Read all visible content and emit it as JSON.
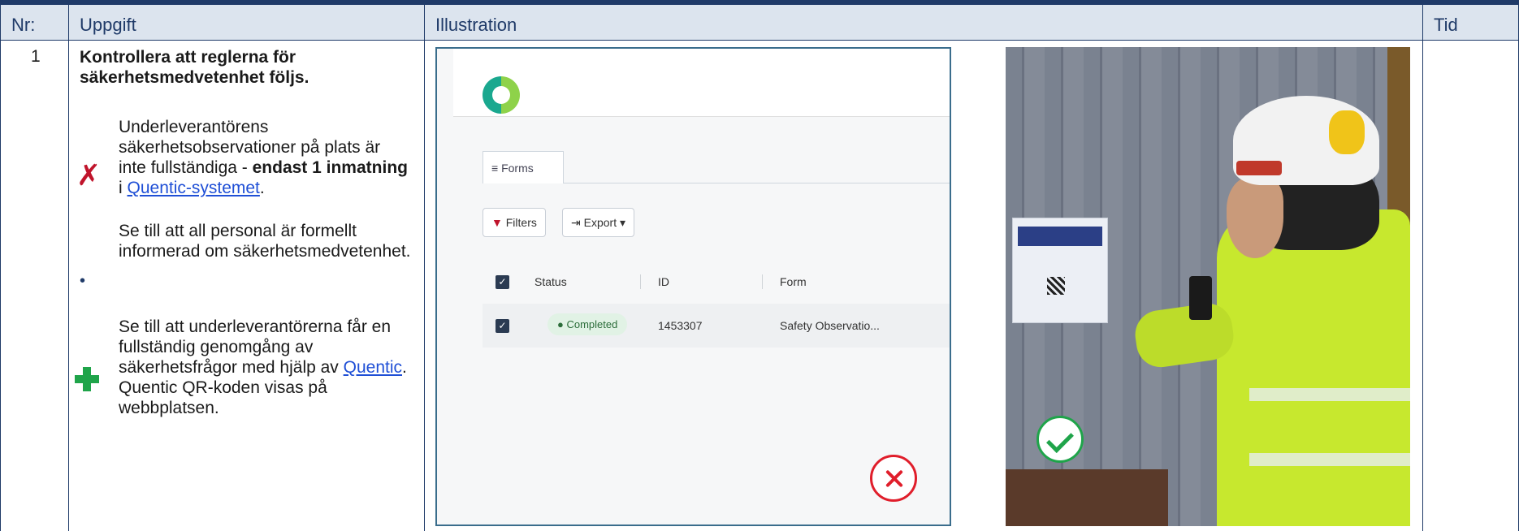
{
  "table_header": {
    "nr": "Nr:",
    "task": "Uppgift",
    "illustration": "Illustration",
    "time": "Tid"
  },
  "row": {
    "nr": "1",
    "title": "Kontrollera att reglerna för säkerhetsmedvetenhet följs.",
    "issue": {
      "text_before": "Underleverantörens säkerhetsobservationer på plats är inte fullständiga - ",
      "bold": "endast 1 inmatning",
      "text_mid": " i ",
      "link": "Quentic-systemet",
      "text_after": "."
    },
    "bullet": "Se till att all personal är formellt informerad om säkerhetsmedvetenhet.",
    "improve": {
      "text_before": "Se till att underleverantörerna får en fullständig genomgång av säkerhetsfrågor med hjälp av ",
      "link": "Quentic",
      "text_after": ". Quentic QR-koden visas på webbplatsen."
    }
  },
  "screenshot": {
    "tab": "Forms",
    "filters_btn": "Filters",
    "export_btn": "Export",
    "columns": [
      "Status",
      "ID",
      "Form"
    ],
    "row": {
      "status": "Completed",
      "id": "1453307",
      "form": "Safety Observatio..."
    }
  },
  "icons": {
    "issue": "red-x-mark-icon",
    "improve": "green-plus-icon",
    "bad": "red-circle-x-icon",
    "good": "green-circle-check-icon"
  },
  "colors": {
    "header_bg": "#dce4ee",
    "rule": "#1f3a68",
    "link": "#1f4fd6",
    "red": "#c0142b",
    "green": "#1fa44a"
  }
}
